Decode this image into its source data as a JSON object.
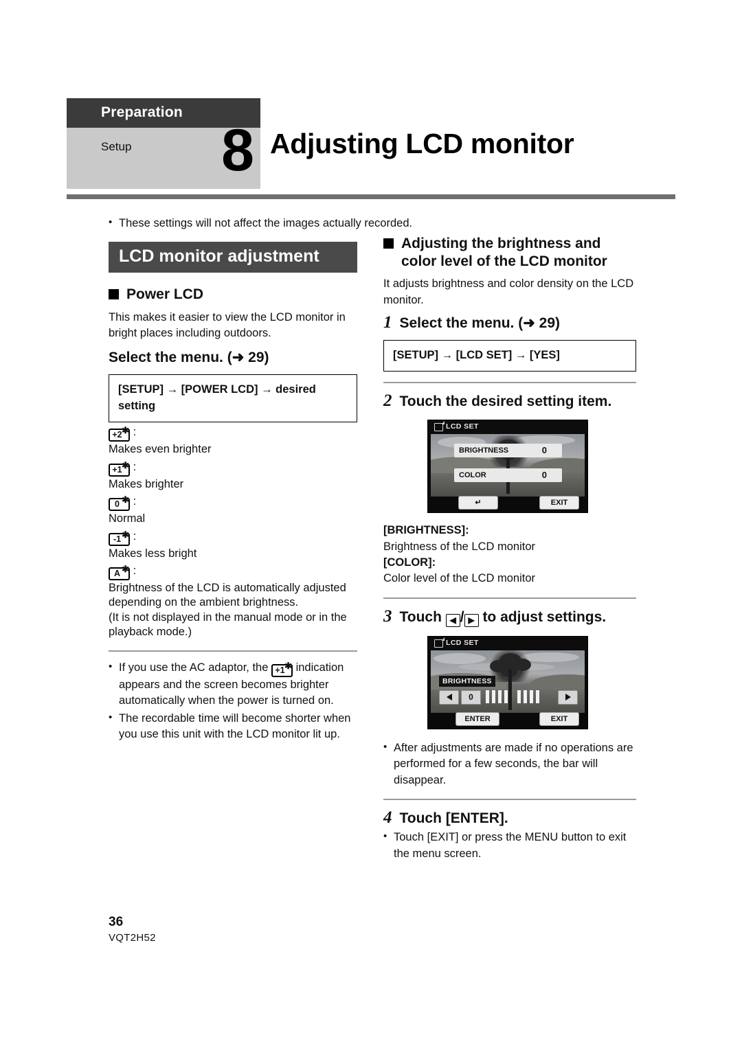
{
  "header": {
    "category": "Preparation",
    "subcategory": "Setup",
    "step_number": "8",
    "title": "Adjusting LCD monitor"
  },
  "intro_note": "These settings will not affect the images actually recorded.",
  "left_column": {
    "section_band": "LCD monitor adjustment",
    "subsection_heading": "Power LCD",
    "description": "This makes it easier to view the LCD monitor in bright places including outdoors.",
    "select_menu_heading": "Select the menu. (➜ 29)",
    "menu_path": "[SETUP] → [POWER LCD] → desired setting",
    "settings": [
      {
        "icon_label": "+2",
        "icon_name": "power-lcd-plus2-icon",
        "description": "Makes even brighter"
      },
      {
        "icon_label": "+1",
        "icon_name": "power-lcd-plus1-icon",
        "description": "Makes brighter"
      },
      {
        "icon_label": "0",
        "icon_name": "power-lcd-zero-icon",
        "description": "Normal"
      },
      {
        "icon_label": "-1",
        "icon_name": "power-lcd-minus1-icon",
        "description": "Makes less bright"
      },
      {
        "icon_label": "A",
        "icon_name": "power-lcd-auto-icon",
        "description": "Brightness of the LCD is automatically adjusted depending on the ambient brightness.\n(It is not displayed in the manual mode or in the playback mode.)"
      }
    ],
    "notes": [
      {
        "part1": "If you use the AC adaptor, the ",
        "icon_label": "+1",
        "part2": " indication appears and the screen becomes brighter automatically when the power is turned on."
      },
      {
        "part1": "The recordable time will become shorter when you use this unit with the LCD monitor lit up.",
        "icon_label": "",
        "part2": ""
      }
    ]
  },
  "right_column": {
    "subsection_heading_line1": "Adjusting the brightness and",
    "subsection_heading_line2": "color level of the LCD monitor",
    "description": "It adjusts brightness and color density on the LCD monitor.",
    "steps": [
      {
        "number": "1",
        "text": "Select the menu. (➜ 29)"
      },
      {
        "number": "2",
        "text": "Touch the desired setting item."
      },
      {
        "number": "3",
        "text_before": "Touch ",
        "text_after": " to adjust settings."
      },
      {
        "number": "4",
        "text": "Touch [ENTER]."
      }
    ],
    "menu_path": "[SETUP] → [LCD SET] → [YES]",
    "screen_one": {
      "title": "LCD SET",
      "rows": [
        {
          "label": "BRIGHTNESS",
          "value": "0"
        },
        {
          "label": "COLOR",
          "value": "0"
        }
      ],
      "back_button": "↵",
      "exit_button": "EXIT"
    },
    "definitions": [
      {
        "term": "[BRIGHTNESS]:",
        "meaning": "Brightness of the LCD monitor"
      },
      {
        "term": "[COLOR]:",
        "meaning": "Color level of the LCD monitor"
      }
    ],
    "screen_two": {
      "title": "LCD SET",
      "bar_label": "BRIGHTNESS",
      "value": "0",
      "enter_button": "ENTER",
      "exit_button": "EXIT",
      "segment_count": 8
    },
    "note_after_step3": "After adjustments are made if no operations are performed for a few seconds, the bar will disappear.",
    "note_after_step4": "Touch [EXIT] or press the MENU button to exit the menu screen."
  },
  "footer": {
    "page_number": "36",
    "document_code": "VQT2H52"
  },
  "colors": {
    "header_dark": "#3b3b3b",
    "header_light": "#c9c9c9",
    "band": "#4a4a4a",
    "rule": "#6f6f6f"
  }
}
